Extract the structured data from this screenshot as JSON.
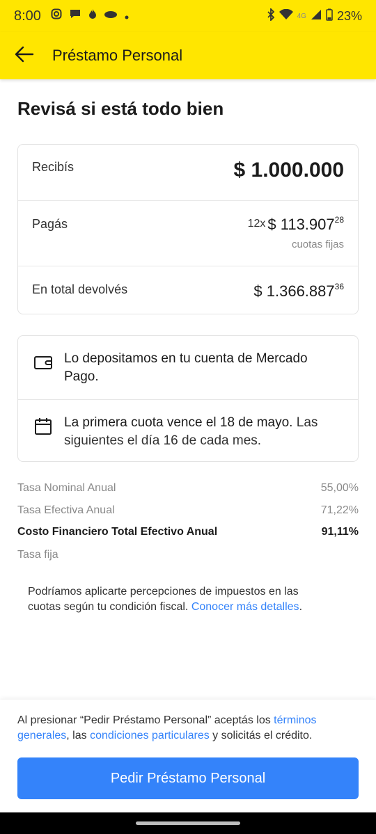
{
  "status_bar": {
    "time": "8:00",
    "network": "4G",
    "battery": "23%"
  },
  "app_bar": {
    "title": "Préstamo Personal"
  },
  "page": {
    "title": "Revisá si está todo bien"
  },
  "summary": {
    "receive_label": "Recibís",
    "receive_amount": "$ 1.000.000",
    "pay_label": "Pagás",
    "installments_count": "12x",
    "installment_amount": "$ 113.907",
    "installment_cents": "28",
    "installment_note": "cuotas fijas",
    "total_label": "En total devolvés",
    "total_amount": "$ 1.366.887",
    "total_cents": "36"
  },
  "info": {
    "deposit_text": "Lo depositamos en tu cuenta de Mercado Pago.",
    "first_due_strong": "La primera cuota vence el 18 de mayo.",
    "first_due_rest": " Las siguientes el día 16 de cada mes."
  },
  "rates": {
    "tna_label": "Tasa Nominal Anual",
    "tna_value": "55,00%",
    "tea_label": "Tasa Efectiva Anual",
    "tea_value": "71,22%",
    "cftea_label": "Costo Financiero Total Efectivo Anual",
    "cftea_value": "91,11%",
    "fixed_label": "Tasa fija"
  },
  "disclaimer": {
    "text": "Podríamos aplicarte percepciones de impuestos en las cuotas según tu condición fiscal. ",
    "link": "Conocer más detalles",
    "end": "."
  },
  "footer": {
    "terms_prefix": "Al presionar “Pedir Préstamo Personal” aceptás los ",
    "terms_link1": "términos generales",
    "terms_mid": ", las ",
    "terms_link2": "condiciones particulares",
    "terms_suffix": " y solicitás el crédito.",
    "cta_label": "Pedir Préstamo Personal"
  },
  "colors": {
    "brand_yellow": "#ffe600",
    "accent_blue": "#3483fa"
  }
}
